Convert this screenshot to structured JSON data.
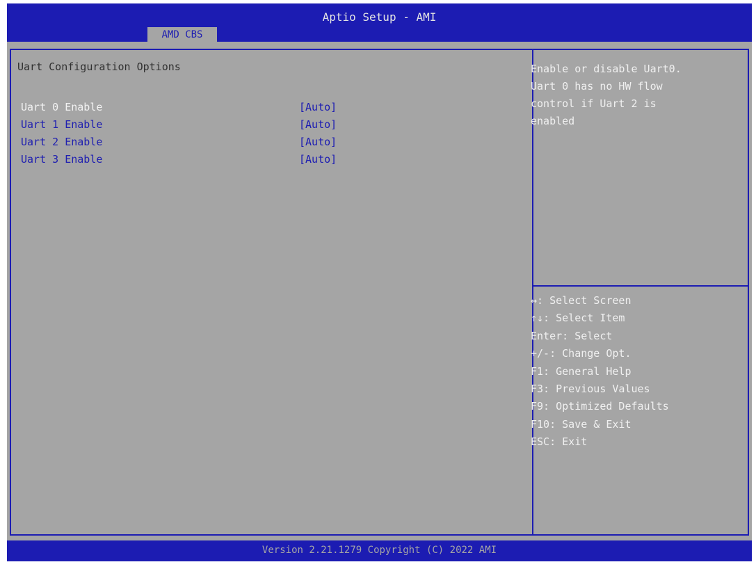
{
  "header": {
    "title": "Aptio Setup - AMI",
    "tabs": [
      {
        "label": "AMD CBS"
      }
    ]
  },
  "main": {
    "section_title": "Uart Configuration Options",
    "options": [
      {
        "label": "Uart 0 Enable",
        "value": "[Auto]",
        "selected": true
      },
      {
        "label": "Uart 1 Enable",
        "value": "[Auto]",
        "selected": false
      },
      {
        "label": "Uart 2 Enable",
        "value": "[Auto]",
        "selected": false
      },
      {
        "label": "Uart 3 Enable",
        "value": "[Auto]",
        "selected": false
      }
    ]
  },
  "help": {
    "lines": [
      "Enable or disable Uart0.",
      "Uart 0 has no HW flow",
      "control if Uart 2 is",
      "enabled"
    ]
  },
  "keys": [
    "↔: Select Screen",
    "↑↓: Select Item",
    "Enter: Select",
    "+/-: Change Opt.",
    "F1: General Help",
    "F3: Previous Values",
    "F9: Optimized Defaults",
    "F10: Save & Exit",
    "ESC: Exit"
  ],
  "footer": {
    "version": "Version 2.21.1279 Copyright (C) 2022 AMI"
  },
  "colors": {
    "bar": "#1c1cb2",
    "background": "#a5a5a5",
    "highlight_text": "#f2f2f2"
  }
}
